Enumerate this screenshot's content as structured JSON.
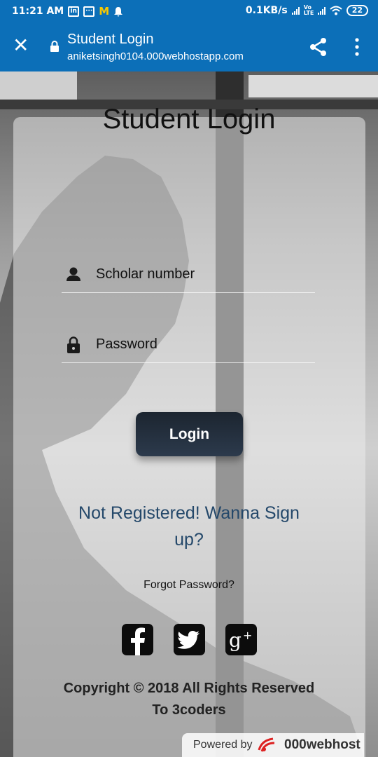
{
  "status_bar": {
    "time": "11:21 AM",
    "net_speed": "0.1KB/s",
    "volte": "Vo LTE",
    "battery": "22"
  },
  "browser": {
    "page_title": "Student Login",
    "url": "aniketsingh0104.000webhostapp.com"
  },
  "login": {
    "heading": "Student Login",
    "scholar_placeholder": "Scholar number",
    "password_placeholder": "Password",
    "login_label": "Login",
    "signup_text": "Not Registered! Wanna Sign up?",
    "forgot_text": "Forgot Password?"
  },
  "social": [
    "facebook",
    "twitter",
    "google-plus"
  ],
  "footer": {
    "copyright_line1": "Copyright © 2018 All Rights Reserved",
    "copyright_line2": "To 3coders"
  },
  "powered": {
    "prefix": "Powered by",
    "brand": "000webhost"
  },
  "colors": {
    "header": "#0c6fb8",
    "signup_link": "#24486a",
    "button": "#1c2530"
  }
}
